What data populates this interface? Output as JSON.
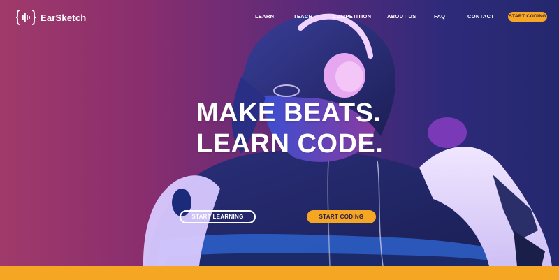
{
  "brand": {
    "name": "EarSketch",
    "logo_icon": "earsketch-logo-icon"
  },
  "nav": {
    "items": [
      {
        "label": "LEARN"
      },
      {
        "label": "TEACH"
      },
      {
        "label": "COMPETITION"
      },
      {
        "label": "ABOUT US"
      },
      {
        "label": "FAQ"
      },
      {
        "label": "CONTACT"
      }
    ],
    "cta_label": "START CODING"
  },
  "hero": {
    "headline_line1": "MAKE BEATS.",
    "headline_line2": "LEARN CODE.",
    "primary_button": "START LEARNING",
    "secondary_button": "START CODING"
  },
  "colors": {
    "accent": "#f5a623",
    "gradient_left": "#a03a6a",
    "gradient_right": "#24286e",
    "text_light": "#ffffff"
  }
}
